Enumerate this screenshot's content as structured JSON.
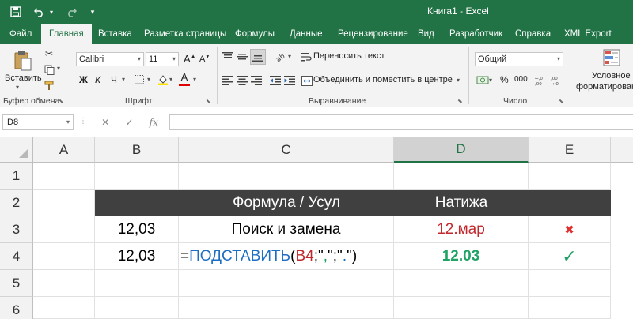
{
  "quick_access": {
    "save_icon": "save-icon",
    "undo_icon": "undo-icon",
    "undo_dropdown_icon": "chevron-down-icon",
    "redo_icon": "redo-icon",
    "customize_icon": "customize-qat-icon"
  },
  "window_title": "Книга1  -  Excel",
  "ribbon_tabs": [
    "Файл",
    "Главная",
    "Вставка",
    "Разметка страницы",
    "Формулы",
    "Данные",
    "Рецензирование",
    "Вид",
    "Разработчик",
    "Справка",
    "XML Export"
  ],
  "active_tab": "Главная",
  "clipboard": {
    "paste_label": "Вставить",
    "group_label": "Буфер обмена"
  },
  "font": {
    "font_name": "Calibri",
    "font_size": "11",
    "grow_label": "A",
    "shrink_label": "A",
    "bold": "Ж",
    "italic": "К",
    "underline": "Ч",
    "font_color_letter": "А",
    "group_label": "Шрифт"
  },
  "alignment": {
    "wrap_text": "Переносить текст",
    "merge_center": "Объединить и поместить в центре",
    "group_label": "Выравнивание"
  },
  "number": {
    "format": "Общий",
    "group_label": "Число",
    "percent": "%",
    "thousands": "000"
  },
  "styles": {
    "conditional_formatting_line1": "Условное",
    "conditional_formatting_line2": "форматирование"
  },
  "formula_bar": {
    "name_box": "D8",
    "cancel": "✕",
    "confirm": "✓",
    "fx": "fx",
    "value": ""
  },
  "sheet": {
    "columns": [
      "A",
      "B",
      "C",
      "D",
      "E"
    ],
    "selected_column": "D",
    "rows": [
      "1",
      "2",
      "3",
      "4",
      "5",
      "6"
    ],
    "header_row": {
      "c": "Формула / Усул",
      "d": "Натижа"
    },
    "row3": {
      "b": "12,03",
      "c": "Поиск и замена",
      "d": "12.мар",
      "e_icon": "cross-icon",
      "e_glyph": "✖"
    },
    "row4": {
      "b": "12,03",
      "formula": {
        "eq": "=",
        "fn": "ПОДСТАВИТЬ",
        "open": "(",
        "ref": "B4",
        "sep1": ";\"",
        "arg1": ",",
        "sep2": "\";\"",
        "arg2": ".",
        "close": "\")"
      },
      "d": "12.03",
      "e_icon": "check-icon",
      "e_glyph": "✓"
    },
    "colors": {
      "header_band": "#404040",
      "result_error": "#c0282d",
      "result_ok": "#21a366",
      "function_blue": "#1e6fc4",
      "excel_green": "#217346"
    }
  }
}
